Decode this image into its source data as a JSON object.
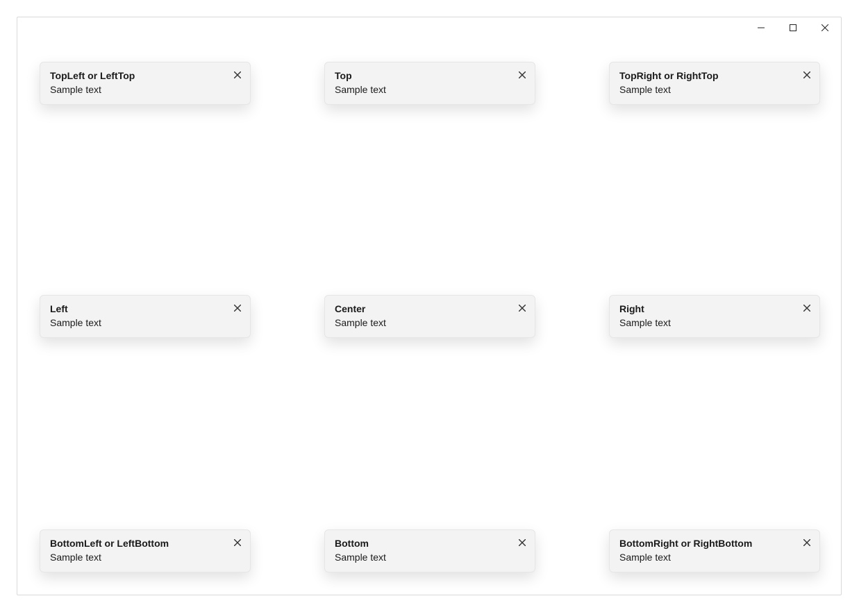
{
  "window": {
    "title": ""
  },
  "snackbars": {
    "top_left": {
      "title": "TopLeft or LeftTop",
      "body": "Sample text"
    },
    "top": {
      "title": "Top",
      "body": "Sample text"
    },
    "top_right": {
      "title": "TopRight or RightTop",
      "body": "Sample text"
    },
    "left": {
      "title": "Left",
      "body": "Sample text"
    },
    "center": {
      "title": "Center",
      "body": "Sample text"
    },
    "right": {
      "title": "Right",
      "body": "Sample text"
    },
    "bottom_left": {
      "title": "BottomLeft or LeftBottom",
      "body": "Sample text"
    },
    "bottom": {
      "title": "Bottom",
      "body": "Sample text"
    },
    "bottom_right": {
      "title": "BottomRight or RightBottom",
      "body": "Sample text"
    }
  }
}
